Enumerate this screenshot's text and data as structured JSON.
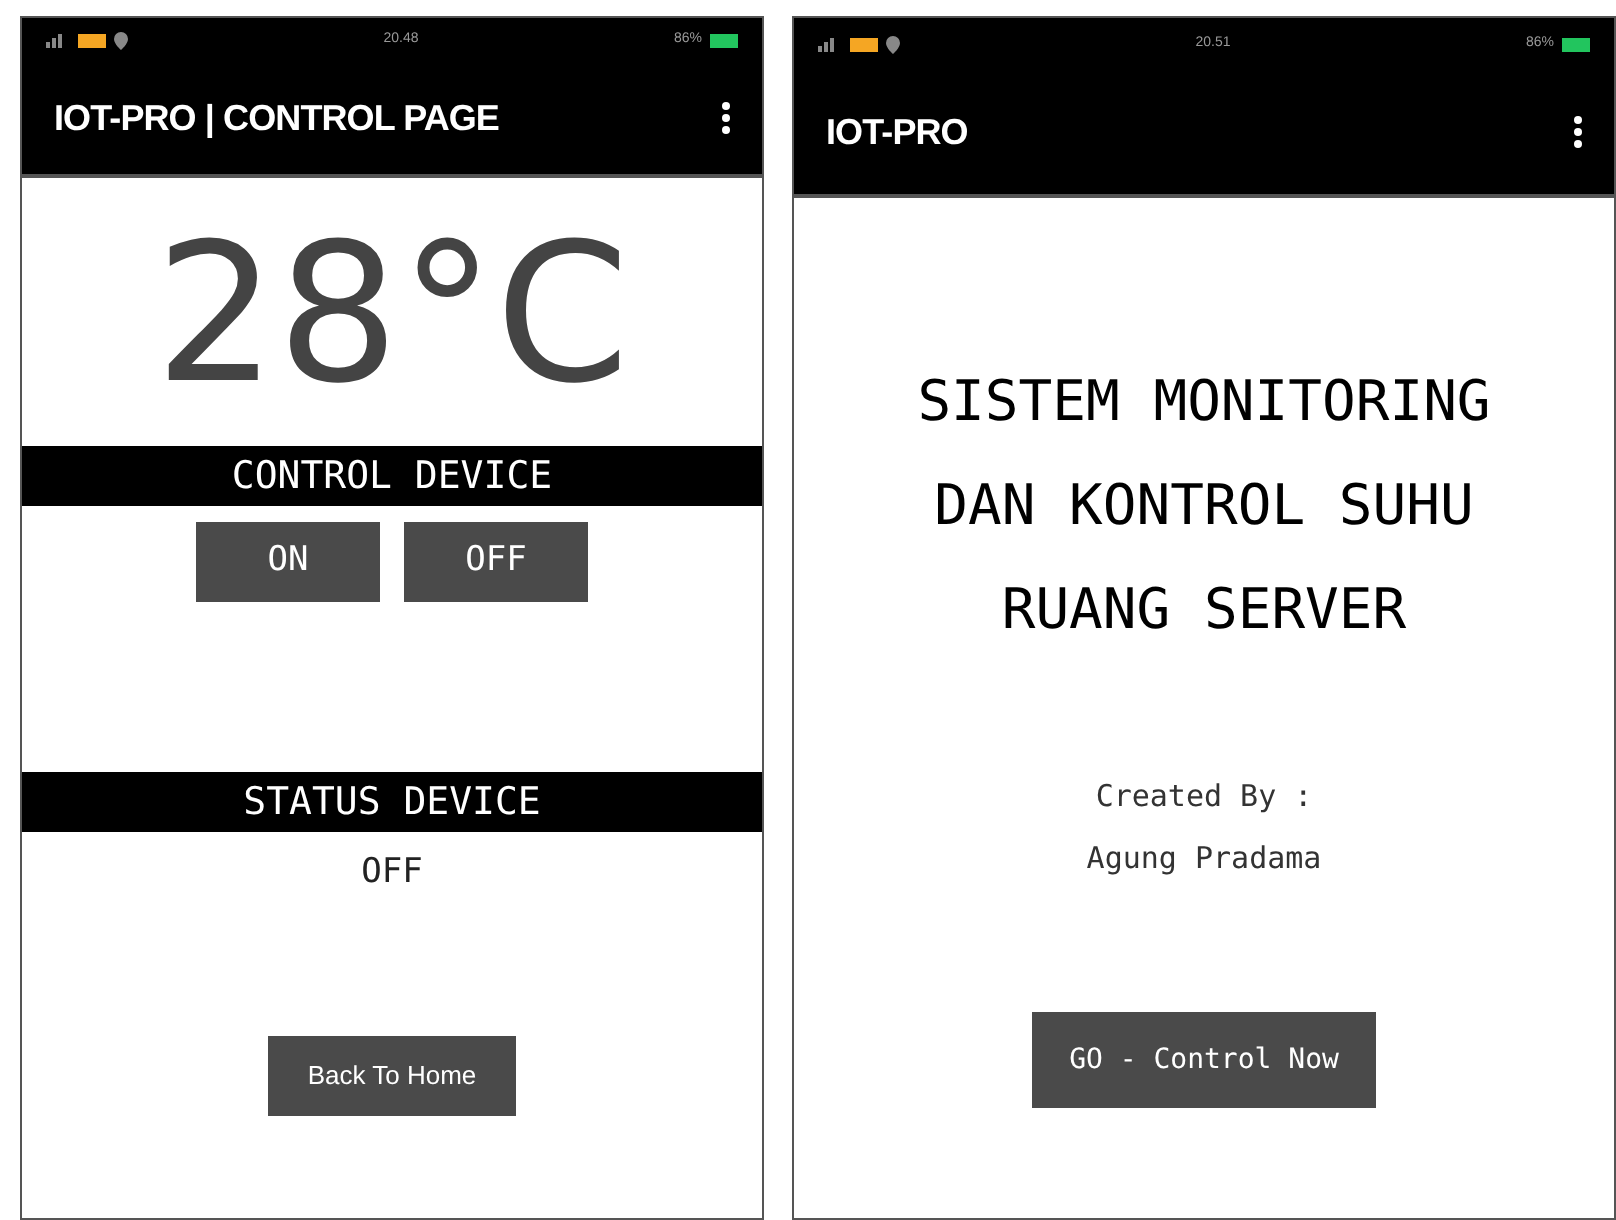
{
  "screens": [
    {
      "kind": "control",
      "status_bar": {
        "time": "20.48",
        "battery": "86%"
      },
      "app_bar": {
        "title": "IOT-PRO | CONTROL PAGE"
      },
      "temperature": "28°C",
      "control_heading": "CONTROL DEVICE",
      "buttons": [
        {
          "label": "ON"
        },
        {
          "label": "OFF"
        }
      ],
      "status_heading": "STATUS DEVICE",
      "status_value": "OFF",
      "back_button": "Back To Home"
    },
    {
      "kind": "home",
      "status_bar": {
        "time": "20.51",
        "battery": "86%"
      },
      "app_bar": {
        "title": "IOT-PRO"
      },
      "headline": [
        "SISTEM MONITORING",
        "DAN KONTROL SUHU",
        "RUANG SERVER"
      ],
      "credit_label": "Created By :",
      "credit_name": "Agung Pradama",
      "go_button": "GO - Control Now"
    }
  ]
}
